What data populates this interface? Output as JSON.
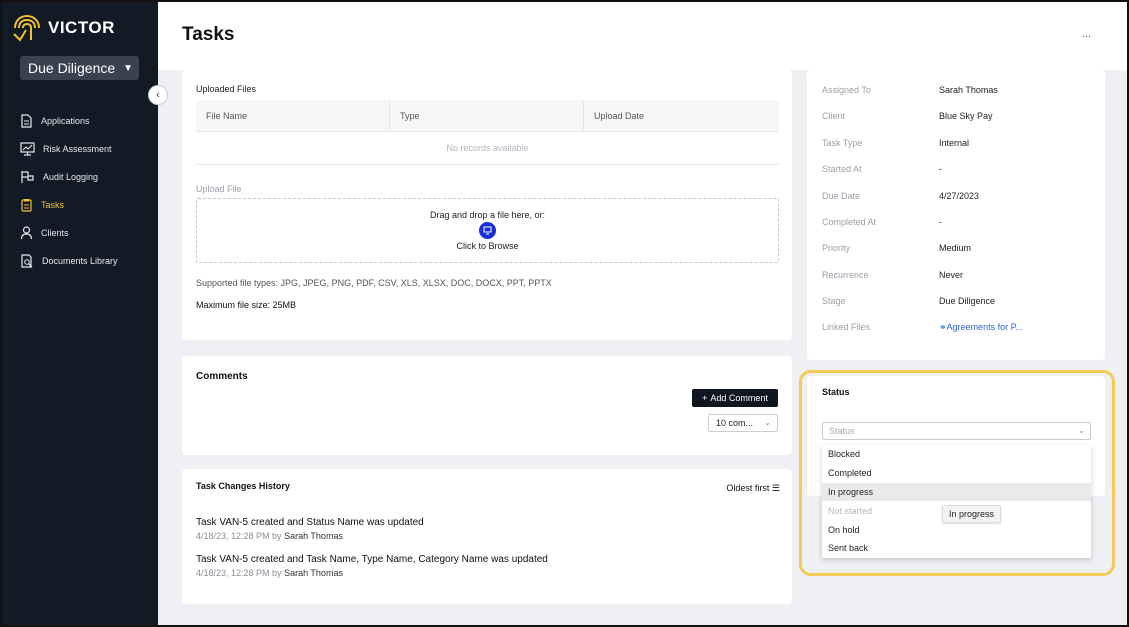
{
  "app": {
    "name": "VICTOR"
  },
  "workspace": {
    "label": "Due Diligence"
  },
  "sidebar": {
    "items": [
      {
        "label": "Applications",
        "icon": "document-icon",
        "active": false
      },
      {
        "label": "Risk Assessment",
        "icon": "chart-monitor-icon",
        "active": false
      },
      {
        "label": "Audit Logging",
        "icon": "flag-icon",
        "active": false
      },
      {
        "label": "Tasks",
        "icon": "clipboard-icon",
        "active": true
      },
      {
        "label": "Clients",
        "icon": "person-icon",
        "active": false
      },
      {
        "label": "Documents Library",
        "icon": "document-search-icon",
        "active": false
      }
    ]
  },
  "header": {
    "title": "Tasks",
    "more": "..."
  },
  "files": {
    "uploaded_label": "Uploaded Files",
    "columns": [
      "File Name",
      "Type",
      "Upload Date"
    ],
    "empty": "No records available",
    "upload_label": "Upload File",
    "drag_text": "Drag and drop a file here, or:",
    "browse_text": "Click to Browse",
    "supported": "Supported file types: JPG, JPEG, PNG, PDF, CSV, XLS, XLSX, DOC, DOCX, PPT, PPTX",
    "max_size": "Maximum file size: 25MB"
  },
  "comments": {
    "title": "Comments",
    "add_label": "Add Comment",
    "page_size": "10 com..."
  },
  "history": {
    "title": "Task Changes History",
    "sort_label": "Oldest first",
    "entries": [
      {
        "text": "Task VAN-5 created and Status Name was updated",
        "meta": "4/18/23, 12:28 PM by",
        "user": "Sarah Thomas"
      },
      {
        "text": "Task VAN-5 created and Task Name, Type Name, Category Name was updated",
        "meta": "4/18/23, 12:28 PM by",
        "user": "Sarah Thomas"
      }
    ]
  },
  "details": {
    "rows": [
      {
        "label": "Assigned To",
        "value": "Sarah Thomas"
      },
      {
        "label": "Client",
        "value": "Blue Sky Pay"
      },
      {
        "label": "Task Type",
        "value": "Internal"
      },
      {
        "label": "Started At",
        "value": "-"
      },
      {
        "label": "Due Date",
        "value": "4/27/2023"
      },
      {
        "label": "Completed At",
        "value": "-"
      },
      {
        "label": "Priority",
        "value": "Medium"
      },
      {
        "label": "Recurrence",
        "value": "Never"
      },
      {
        "label": "Stage",
        "value": "Due Diligence"
      },
      {
        "label": "Linked Files",
        "value": "Agreements for P..."
      }
    ]
  },
  "status": {
    "title": "Status",
    "placeholder": "Status",
    "options": [
      {
        "label": "Blocked",
        "state": "normal"
      },
      {
        "label": "Completed",
        "state": "normal"
      },
      {
        "label": "In progress",
        "state": "hover"
      },
      {
        "label": "Not started",
        "state": "disabled"
      },
      {
        "label": "On hold",
        "state": "normal"
      },
      {
        "label": "Sent back",
        "state": "normal"
      }
    ],
    "tooltip": "In progress"
  },
  "colors": {
    "sidebar_bg": "#121a26",
    "accent": "#f2c230",
    "highlight": "#f5c95a",
    "upload_button": "#1a2fd8",
    "link": "#2f66d0"
  }
}
